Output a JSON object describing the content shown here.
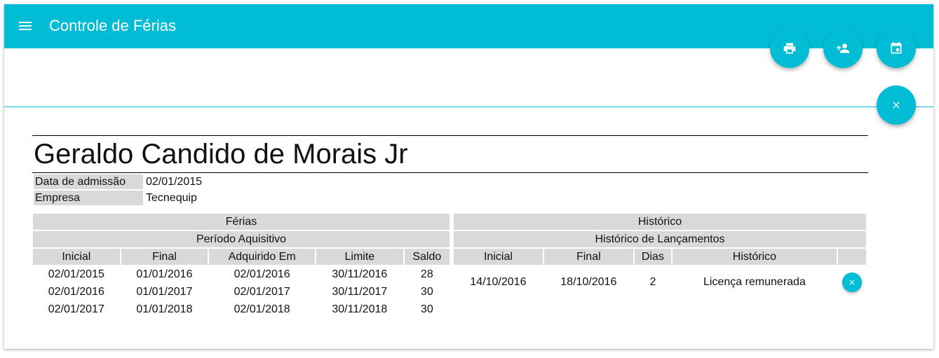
{
  "appbar": {
    "title": "Controle de Férias"
  },
  "actions": {
    "print_icon": "print-icon",
    "add_person_icon": "person-add-icon",
    "calendar_icon": "calendar-icon",
    "close_icon": "close-icon"
  },
  "employee": {
    "name": "Geraldo Candido de Morais Jr",
    "admission_label": "Data de admissão",
    "admission_value": "02/01/2015",
    "company_label": "Empresa",
    "company_value": "Tecnequip"
  },
  "ferias": {
    "title": "Férias",
    "subtitle": "Período Aquisitivo",
    "columns": [
      "Inicial",
      "Final",
      "Adquirido Em",
      "Limite",
      "Saldo"
    ],
    "rows": [
      [
        "02/01/2015",
        "01/01/2016",
        "02/01/2016",
        "30/11/2016",
        "28"
      ],
      [
        "02/01/2016",
        "01/01/2017",
        "02/01/2017",
        "30/11/2017",
        "30"
      ],
      [
        "02/01/2017",
        "01/01/2018",
        "02/01/2018",
        "30/11/2018",
        "30"
      ]
    ]
  },
  "historico": {
    "title": "Histórico",
    "subtitle": "Histórico de Lançamentos",
    "columns": [
      "Inicial",
      "Final",
      "Dias",
      "Histórico",
      ""
    ],
    "rows": [
      [
        "14/10/2016",
        "18/10/2016",
        "2",
        "Licença remunerada"
      ]
    ]
  },
  "colors": {
    "accent": "#00bcd4",
    "header_bg": "#d9d9d9"
  }
}
